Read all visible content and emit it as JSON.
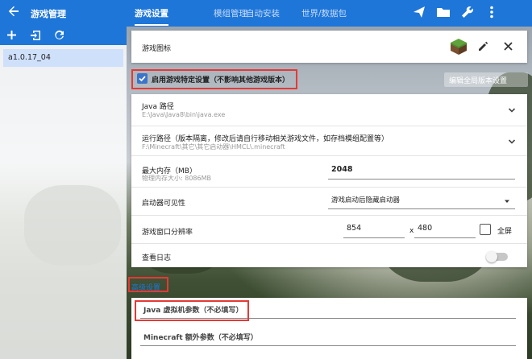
{
  "colors": {
    "topbar": "#1e76d9",
    "accent": "#3b74c8",
    "highlight": "#e53935"
  },
  "app": {
    "title": "游戏管理"
  },
  "tabs": [
    {
      "label": "游戏设置",
      "active": true
    },
    {
      "label": "模组管理",
      "active": false
    },
    {
      "label": "自动安装",
      "active": false
    },
    {
      "label": "世界/数据包",
      "active": false
    }
  ],
  "toolbar_icons": [
    "send-icon",
    "folder-icon",
    "wrench-icon",
    "more-vertical-icon"
  ],
  "sidebar": {
    "actions": [
      "add-icon",
      "import-icon",
      "refresh-icon"
    ],
    "versions": [
      {
        "label": "a1.0.17_04",
        "selected": true
      }
    ]
  },
  "game_icon_row": {
    "label": "游戏图标"
  },
  "specific_settings": {
    "label": "启用游戏特定设置（不影响其他游戏版本）",
    "checked": true
  },
  "edit_global_button": {
    "label": "编辑全局版本设置"
  },
  "settings": {
    "java_path": {
      "label": "Java 路径",
      "value": "E:\\Java\\Java8\\bin\\java.exe"
    },
    "run_path": {
      "label": "运行路径（版本隔离，修改后请自行移动相关游戏文件，如存档模组配置等）",
      "value": "F:\\Minecraft\\其它\\其它启动器\\HMCL\\.minecraft"
    },
    "max_memory": {
      "label": "最大内存（MB）",
      "sub": "物理内存大小: 8086MB",
      "value": "2048"
    },
    "launcher_visibility": {
      "label": "启动器可见性",
      "value": "游戏启动后隐藏启动器"
    },
    "window_resolution": {
      "label": "游戏窗口分辨率",
      "width": "854",
      "separator": "x",
      "height": "480",
      "fullscreen_label": "全屏"
    },
    "show_logs": {
      "label": "查看日志",
      "enabled": false
    }
  },
  "advanced": {
    "section_title": "高级设置",
    "jvm_args": {
      "placeholder": "Java 虚拟机参数（不必填写）"
    },
    "mc_args": {
      "placeholder": "Minecraft 额外参数（不必填写）"
    }
  }
}
